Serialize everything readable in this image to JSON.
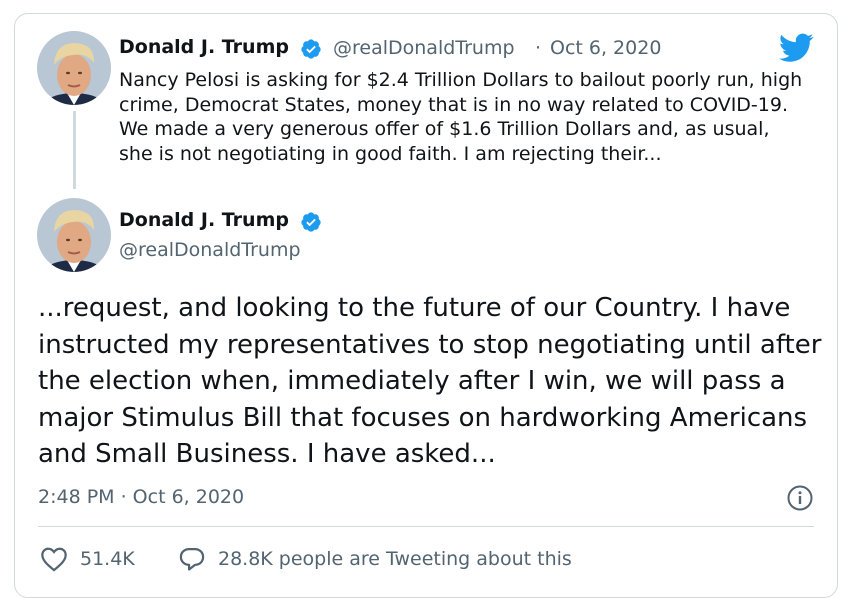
{
  "parent_tweet": {
    "author_name": "Donald J. Trump",
    "handle": "@realDonaldTrump",
    "separator": "·",
    "date": "Oct 6, 2020",
    "text": "Nancy Pelosi is asking for $2.4 Trillion Dollars to bailout poorly run, high crime, Democrat States, money that is in no way related to COVID-19. We made a very generous offer of $1.6 Trillion Dollars and, as usual, she is not negotiating in good faith. I am rejecting their..."
  },
  "main_tweet": {
    "author_name": "Donald J. Trump",
    "handle": "@realDonaldTrump",
    "text": "...request, and looking to the future of our Country. I have instructed my representatives to stop negotiating until after the election when, immediately after I win, we will pass a major Stimulus Bill that focuses on hardworking Americans and Small Business. I have asked...",
    "timestamp": "2:48 PM · Oct 6, 2020"
  },
  "actions": {
    "like_count": "51.4K",
    "reply_text": "28.8K people are Tweeting about this"
  },
  "icons": {
    "verified": "verified-badge-icon",
    "twitter": "twitter-bird-icon",
    "info": "info-icon",
    "heart": "heart-icon",
    "comment": "comment-icon"
  },
  "colors": {
    "twitter_blue": "#1d9bf0",
    "text_primary": "#0f1419",
    "text_secondary": "#536471",
    "border": "#cfd9de"
  }
}
